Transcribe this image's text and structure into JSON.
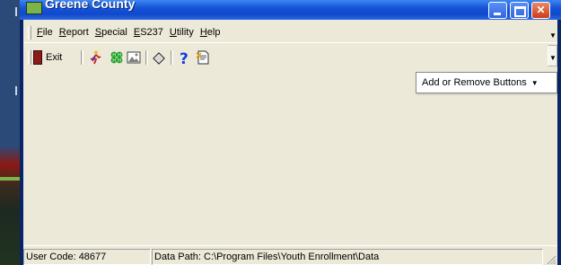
{
  "window": {
    "title": "Greene County"
  },
  "menu": {
    "items": [
      {
        "label": "File",
        "u": "F",
        "rest": "ile"
      },
      {
        "label": "Report",
        "u": "R",
        "rest": "eport"
      },
      {
        "label": "Special",
        "u": "S",
        "rest": "pecial"
      },
      {
        "label": "ES237",
        "u": "E",
        "rest": "S237"
      },
      {
        "label": "Utility",
        "u": "U",
        "rest": "tility"
      },
      {
        "label": "Help",
        "u": "H",
        "rest": "elp"
      }
    ]
  },
  "toolbar": {
    "exit_label": "Exit",
    "exit_u": "x",
    "icons": [
      "runner-icon",
      "clover-icon",
      "picture-icon",
      "eraser-icon",
      "help-icon",
      "document-icon"
    ],
    "add_remove_label": "Add or Remove Buttons",
    "add_remove_u": "A"
  },
  "statusbar": {
    "user_code": "User Code:  48677",
    "data_path": "Data Path:  C:\\Program Files\\Youth Enrollment\\Data"
  },
  "colors": {
    "titlebar": "#1654d8",
    "client": "#ece9d8",
    "close_button": "#cc3c16"
  }
}
